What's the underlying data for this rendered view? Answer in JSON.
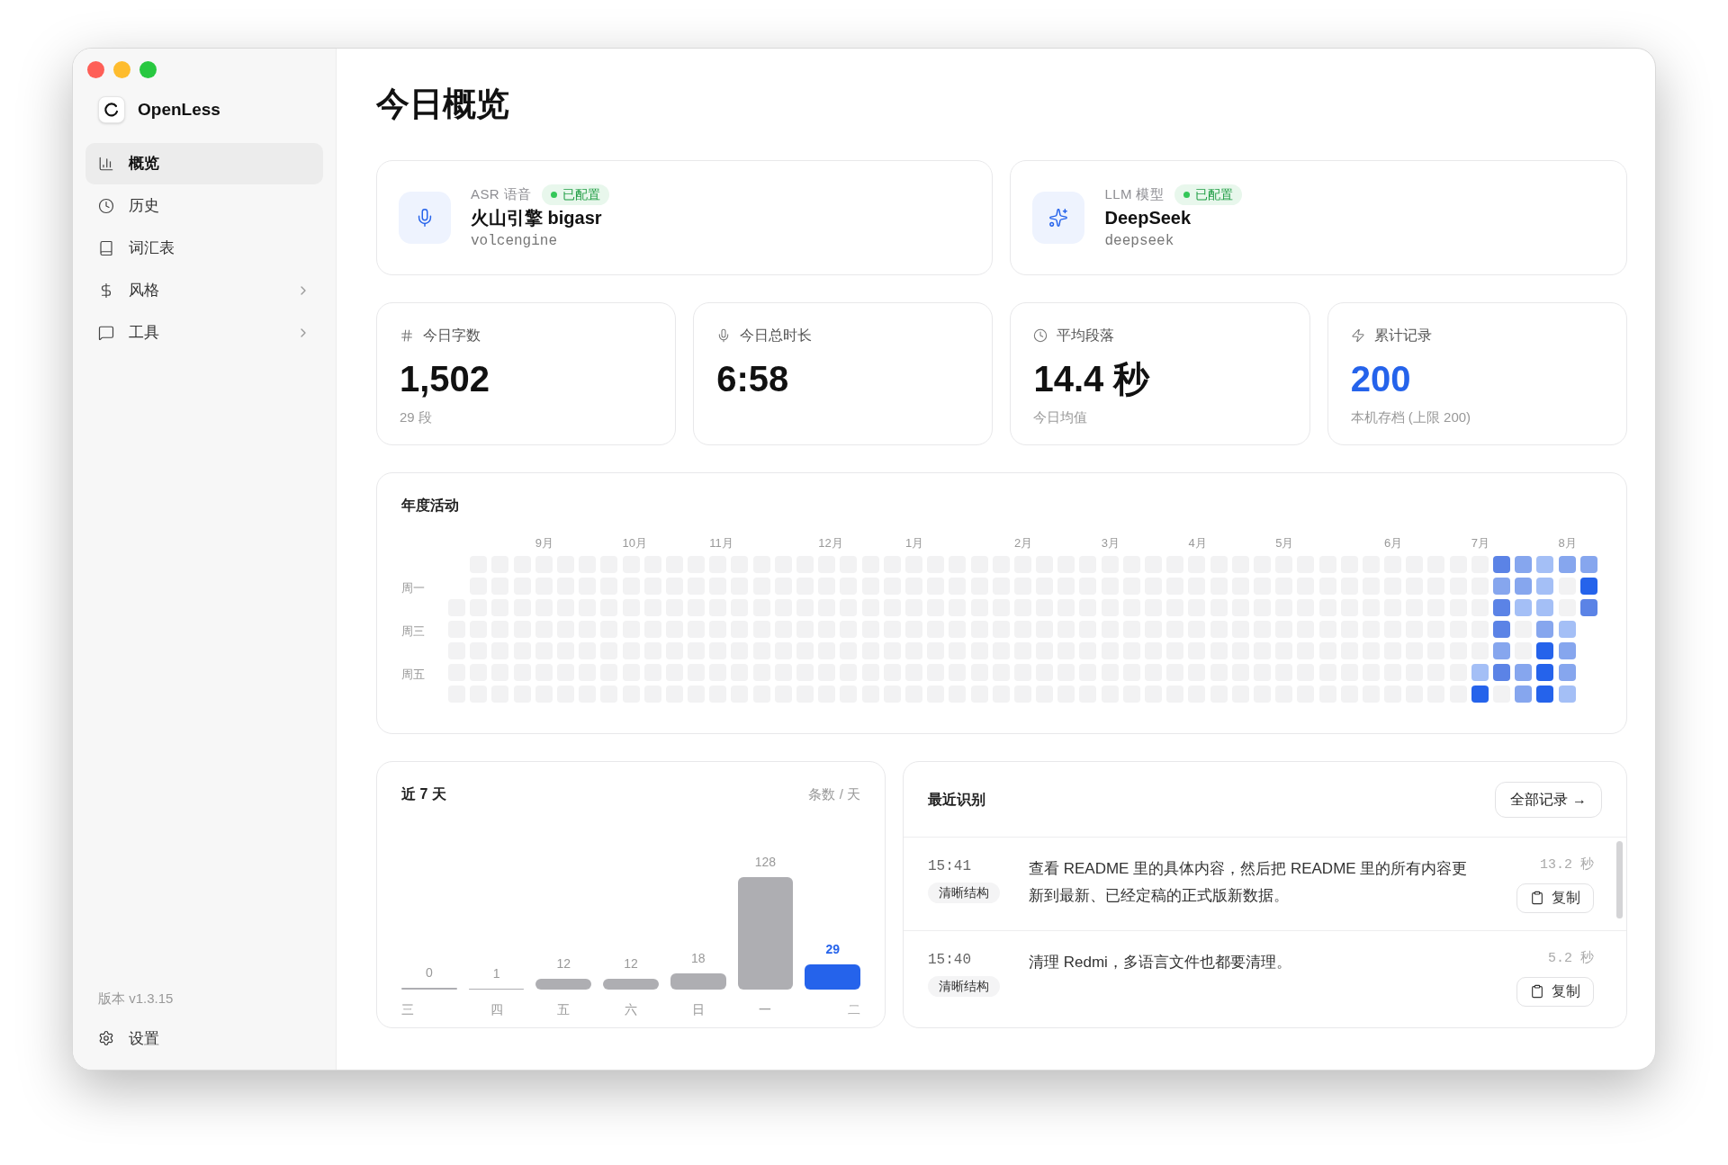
{
  "sidebar": {
    "app_name": "OpenLess",
    "items": [
      {
        "label": "概览",
        "selected": true,
        "has_submenu": false
      },
      {
        "label": "历史",
        "selected": false,
        "has_submenu": false
      },
      {
        "label": "词汇表",
        "selected": false,
        "has_submenu": false
      },
      {
        "label": "风格",
        "selected": false,
        "has_submenu": true
      },
      {
        "label": "工具",
        "selected": false,
        "has_submenu": true
      }
    ],
    "version": "版本 v1.3.15",
    "settings": "设置"
  },
  "page_title": "今日概览",
  "providers": [
    {
      "label": "ASR 语音",
      "status": {
        "label": "已配置",
        "color": "#34c759"
      },
      "name": "火山引擎 bigasr",
      "id": "volcengine"
    },
    {
      "label": "LLM 模型",
      "status": {
        "label": "已配置",
        "color": "#34c759"
      },
      "name": "DeepSeek",
      "id": "deepseek"
    }
  ],
  "stats": [
    {
      "label": "今日字数",
      "value": "1,502",
      "sub": "29 段",
      "accent": false
    },
    {
      "label": "今日总时长",
      "value": "6:58",
      "accent": false
    },
    {
      "label": "平均段落",
      "value": "14.4 秒",
      "sub": "今日均值",
      "accent": false
    },
    {
      "label": "累计记录",
      "value": "200",
      "sub": "本机存档 (上限 200)",
      "accent": true
    }
  ],
  "activity": {
    "title": "年度活动",
    "day_labels": [
      "周一",
      "周三",
      "周五"
    ],
    "weeks": [
      {
        "cells": [
          null,
          null,
          {
            "color": "#f2f2f3"
          },
          {
            "color": "#f2f2f3"
          },
          {
            "color": "#f2f2f3"
          },
          {
            "color": "#f2f2f3"
          },
          {
            "color": "#f2f2f3"
          }
        ]
      },
      {
        "cells": [
          {
            "color": "#f2f2f3"
          },
          {
            "color": "#f2f2f3"
          },
          {
            "color": "#f2f2f3"
          },
          {
            "color": "#f2f2f3"
          },
          {
            "color": "#f2f2f3"
          },
          {
            "color": "#f2f2f3"
          },
          {
            "color": "#f2f2f3"
          }
        ]
      },
      {
        "cells": [
          {
            "color": "#f2f2f3"
          },
          {
            "color": "#f2f2f3"
          },
          {
            "color": "#f2f2f3"
          },
          {
            "color": "#f2f2f3"
          },
          {
            "color": "#f2f2f3"
          },
          {
            "color": "#f2f2f3"
          },
          {
            "color": "#f2f2f3"
          }
        ]
      },
      {
        "cells": [
          {
            "color": "#f2f2f3"
          },
          {
            "color": "#f2f2f3"
          },
          {
            "color": "#f2f2f3"
          },
          {
            "color": "#f2f2f3"
          },
          {
            "color": "#f2f2f3"
          },
          {
            "color": "#f2f2f3"
          },
          {
            "color": "#f2f2f3"
          }
        ]
      },
      {
        "month": "9月",
        "cells": [
          {
            "color": "#f2f2f3"
          },
          {
            "color": "#f2f2f3"
          },
          {
            "color": "#f2f2f3"
          },
          {
            "color": "#f2f2f3"
          },
          {
            "color": "#f2f2f3"
          },
          {
            "color": "#f2f2f3"
          },
          {
            "color": "#f2f2f3"
          }
        ]
      },
      {
        "cells": [
          {
            "color": "#f2f2f3"
          },
          {
            "color": "#f2f2f3"
          },
          {
            "color": "#f2f2f3"
          },
          {
            "color": "#f2f2f3"
          },
          {
            "color": "#f2f2f3"
          },
          {
            "color": "#f2f2f3"
          },
          {
            "color": "#f2f2f3"
          }
        ]
      },
      {
        "cells": [
          {
            "color": "#f2f2f3"
          },
          {
            "color": "#f2f2f3"
          },
          {
            "color": "#f2f2f3"
          },
          {
            "color": "#f2f2f3"
          },
          {
            "color": "#f2f2f3"
          },
          {
            "color": "#f2f2f3"
          },
          {
            "color": "#f2f2f3"
          }
        ]
      },
      {
        "cells": [
          {
            "color": "#f2f2f3"
          },
          {
            "color": "#f2f2f3"
          },
          {
            "color": "#f2f2f3"
          },
          {
            "color": "#f2f2f3"
          },
          {
            "color": "#f2f2f3"
          },
          {
            "color": "#f2f2f3"
          },
          {
            "color": "#f2f2f3"
          }
        ]
      },
      {
        "month": "10月",
        "cells": [
          {
            "color": "#f2f2f3"
          },
          {
            "color": "#f2f2f3"
          },
          {
            "color": "#f2f2f3"
          },
          {
            "color": "#f2f2f3"
          },
          {
            "color": "#f2f2f3"
          },
          {
            "color": "#f2f2f3"
          },
          {
            "color": "#f2f2f3"
          }
        ]
      },
      {
        "cells": [
          {
            "color": "#f2f2f3"
          },
          {
            "color": "#f2f2f3"
          },
          {
            "color": "#f2f2f3"
          },
          {
            "color": "#f2f2f3"
          },
          {
            "color": "#f2f2f3"
          },
          {
            "color": "#f2f2f3"
          },
          {
            "color": "#f2f2f3"
          }
        ]
      },
      {
        "cells": [
          {
            "color": "#f2f2f3"
          },
          {
            "color": "#f2f2f3"
          },
          {
            "color": "#f2f2f3"
          },
          {
            "color": "#f2f2f3"
          },
          {
            "color": "#f2f2f3"
          },
          {
            "color": "#f2f2f3"
          },
          {
            "color": "#f2f2f3"
          }
        ]
      },
      {
        "cells": [
          {
            "color": "#f2f2f3"
          },
          {
            "color": "#f2f2f3"
          },
          {
            "color": "#f2f2f3"
          },
          {
            "color": "#f2f2f3"
          },
          {
            "color": "#f2f2f3"
          },
          {
            "color": "#f2f2f3"
          },
          {
            "color": "#f2f2f3"
          }
        ]
      },
      {
        "month": "11月",
        "cells": [
          {
            "color": "#f2f2f3"
          },
          {
            "color": "#f2f2f3"
          },
          {
            "color": "#f2f2f3"
          },
          {
            "color": "#f2f2f3"
          },
          {
            "color": "#f2f2f3"
          },
          {
            "color": "#f2f2f3"
          },
          {
            "color": "#f2f2f3"
          }
        ]
      },
      {
        "cells": [
          {
            "color": "#f2f2f3"
          },
          {
            "color": "#f2f2f3"
          },
          {
            "color": "#f2f2f3"
          },
          {
            "color": "#f2f2f3"
          },
          {
            "color": "#f2f2f3"
          },
          {
            "color": "#f2f2f3"
          },
          {
            "color": "#f2f2f3"
          }
        ]
      },
      {
        "cells": [
          {
            "color": "#f2f2f3"
          },
          {
            "color": "#f2f2f3"
          },
          {
            "color": "#f2f2f3"
          },
          {
            "color": "#f2f2f3"
          },
          {
            "color": "#f2f2f3"
          },
          {
            "color": "#f2f2f3"
          },
          {
            "color": "#f2f2f3"
          }
        ]
      },
      {
        "cells": [
          {
            "color": "#f2f2f3"
          },
          {
            "color": "#f2f2f3"
          },
          {
            "color": "#f2f2f3"
          },
          {
            "color": "#f2f2f3"
          },
          {
            "color": "#f2f2f3"
          },
          {
            "color": "#f2f2f3"
          },
          {
            "color": "#f2f2f3"
          }
        ]
      },
      {
        "cells": [
          {
            "color": "#f2f2f3"
          },
          {
            "color": "#f2f2f3"
          },
          {
            "color": "#f2f2f3"
          },
          {
            "color": "#f2f2f3"
          },
          {
            "color": "#f2f2f3"
          },
          {
            "color": "#f2f2f3"
          },
          {
            "color": "#f2f2f3"
          }
        ]
      },
      {
        "month": "12月",
        "cells": [
          {
            "color": "#f2f2f3"
          },
          {
            "color": "#f2f2f3"
          },
          {
            "color": "#f2f2f3"
          },
          {
            "color": "#f2f2f3"
          },
          {
            "color": "#f2f2f3"
          },
          {
            "color": "#f2f2f3"
          },
          {
            "color": "#f2f2f3"
          }
        ]
      },
      {
        "cells": [
          {
            "color": "#f2f2f3"
          },
          {
            "color": "#f2f2f3"
          },
          {
            "color": "#f2f2f3"
          },
          {
            "color": "#f2f2f3"
          },
          {
            "color": "#f2f2f3"
          },
          {
            "color": "#f2f2f3"
          },
          {
            "color": "#f2f2f3"
          }
        ]
      },
      {
        "cells": [
          {
            "color": "#f2f2f3"
          },
          {
            "color": "#f2f2f3"
          },
          {
            "color": "#f2f2f3"
          },
          {
            "color": "#f2f2f3"
          },
          {
            "color": "#f2f2f3"
          },
          {
            "color": "#f2f2f3"
          },
          {
            "color": "#f2f2f3"
          }
        ]
      },
      {
        "cells": [
          {
            "color": "#f2f2f3"
          },
          {
            "color": "#f2f2f3"
          },
          {
            "color": "#f2f2f3"
          },
          {
            "color": "#f2f2f3"
          },
          {
            "color": "#f2f2f3"
          },
          {
            "color": "#f2f2f3"
          },
          {
            "color": "#f2f2f3"
          }
        ]
      },
      {
        "month": "1月",
        "cells": [
          {
            "color": "#f2f2f3"
          },
          {
            "color": "#f2f2f3"
          },
          {
            "color": "#f2f2f3"
          },
          {
            "color": "#f2f2f3"
          },
          {
            "color": "#f2f2f3"
          },
          {
            "color": "#f2f2f3"
          },
          {
            "color": "#f2f2f3"
          }
        ]
      },
      {
        "cells": [
          {
            "color": "#f2f2f3"
          },
          {
            "color": "#f2f2f3"
          },
          {
            "color": "#f2f2f3"
          },
          {
            "color": "#f2f2f3"
          },
          {
            "color": "#f2f2f3"
          },
          {
            "color": "#f2f2f3"
          },
          {
            "color": "#f2f2f3"
          }
        ]
      },
      {
        "cells": [
          {
            "color": "#f2f2f3"
          },
          {
            "color": "#f2f2f3"
          },
          {
            "color": "#f2f2f3"
          },
          {
            "color": "#f2f2f3"
          },
          {
            "color": "#f2f2f3"
          },
          {
            "color": "#f2f2f3"
          },
          {
            "color": "#f2f2f3"
          }
        ]
      },
      {
        "cells": [
          {
            "color": "#f2f2f3"
          },
          {
            "color": "#f2f2f3"
          },
          {
            "color": "#f2f2f3"
          },
          {
            "color": "#f2f2f3"
          },
          {
            "color": "#f2f2f3"
          },
          {
            "color": "#f2f2f3"
          },
          {
            "color": "#f2f2f3"
          }
        ]
      },
      {
        "cells": [
          {
            "color": "#f2f2f3"
          },
          {
            "color": "#f2f2f3"
          },
          {
            "color": "#f2f2f3"
          },
          {
            "color": "#f2f2f3"
          },
          {
            "color": "#f2f2f3"
          },
          {
            "color": "#f2f2f3"
          },
          {
            "color": "#f2f2f3"
          }
        ]
      },
      {
        "month": "2月",
        "cells": [
          {
            "color": "#f2f2f3"
          },
          {
            "color": "#f2f2f3"
          },
          {
            "color": "#f2f2f3"
          },
          {
            "color": "#f2f2f3"
          },
          {
            "color": "#f2f2f3"
          },
          {
            "color": "#f2f2f3"
          },
          {
            "color": "#f2f2f3"
          }
        ]
      },
      {
        "cells": [
          {
            "color": "#f2f2f3"
          },
          {
            "color": "#f2f2f3"
          },
          {
            "color": "#f2f2f3"
          },
          {
            "color": "#f2f2f3"
          },
          {
            "color": "#f2f2f3"
          },
          {
            "color": "#f2f2f3"
          },
          {
            "color": "#f2f2f3"
          }
        ]
      },
      {
        "cells": [
          {
            "color": "#f2f2f3"
          },
          {
            "color": "#f2f2f3"
          },
          {
            "color": "#f2f2f3"
          },
          {
            "color": "#f2f2f3"
          },
          {
            "color": "#f2f2f3"
          },
          {
            "color": "#f2f2f3"
          },
          {
            "color": "#f2f2f3"
          }
        ]
      },
      {
        "cells": [
          {
            "color": "#f2f2f3"
          },
          {
            "color": "#f2f2f3"
          },
          {
            "color": "#f2f2f3"
          },
          {
            "color": "#f2f2f3"
          },
          {
            "color": "#f2f2f3"
          },
          {
            "color": "#f2f2f3"
          },
          {
            "color": "#f2f2f3"
          }
        ]
      },
      {
        "month": "3月",
        "cells": [
          {
            "color": "#f2f2f3"
          },
          {
            "color": "#f2f2f3"
          },
          {
            "color": "#f2f2f3"
          },
          {
            "color": "#f2f2f3"
          },
          {
            "color": "#f2f2f3"
          },
          {
            "color": "#f2f2f3"
          },
          {
            "color": "#f2f2f3"
          }
        ]
      },
      {
        "cells": [
          {
            "color": "#f2f2f3"
          },
          {
            "color": "#f2f2f3"
          },
          {
            "color": "#f2f2f3"
          },
          {
            "color": "#f2f2f3"
          },
          {
            "color": "#f2f2f3"
          },
          {
            "color": "#f2f2f3"
          },
          {
            "color": "#f2f2f3"
          }
        ]
      },
      {
        "cells": [
          {
            "color": "#f2f2f3"
          },
          {
            "color": "#f2f2f3"
          },
          {
            "color": "#f2f2f3"
          },
          {
            "color": "#f2f2f3"
          },
          {
            "color": "#f2f2f3"
          },
          {
            "color": "#f2f2f3"
          },
          {
            "color": "#f2f2f3"
          }
        ]
      },
      {
        "cells": [
          {
            "color": "#f2f2f3"
          },
          {
            "color": "#f2f2f3"
          },
          {
            "color": "#f2f2f3"
          },
          {
            "color": "#f2f2f3"
          },
          {
            "color": "#f2f2f3"
          },
          {
            "color": "#f2f2f3"
          },
          {
            "color": "#f2f2f3"
          }
        ]
      },
      {
        "month": "4月",
        "cells": [
          {
            "color": "#f2f2f3"
          },
          {
            "color": "#f2f2f3"
          },
          {
            "color": "#f2f2f3"
          },
          {
            "color": "#f2f2f3"
          },
          {
            "color": "#f2f2f3"
          },
          {
            "color": "#f2f2f3"
          },
          {
            "color": "#f2f2f3"
          }
        ]
      },
      {
        "cells": [
          {
            "color": "#f2f2f3"
          },
          {
            "color": "#f2f2f3"
          },
          {
            "color": "#f2f2f3"
          },
          {
            "color": "#f2f2f3"
          },
          {
            "color": "#f2f2f3"
          },
          {
            "color": "#f2f2f3"
          },
          {
            "color": "#f2f2f3"
          }
        ]
      },
      {
        "cells": [
          {
            "color": "#f2f2f3"
          },
          {
            "color": "#f2f2f3"
          },
          {
            "color": "#f2f2f3"
          },
          {
            "color": "#f2f2f3"
          },
          {
            "color": "#f2f2f3"
          },
          {
            "color": "#f2f2f3"
          },
          {
            "color": "#f2f2f3"
          }
        ]
      },
      {
        "cells": [
          {
            "color": "#f2f2f3"
          },
          {
            "color": "#f2f2f3"
          },
          {
            "color": "#f2f2f3"
          },
          {
            "color": "#f2f2f3"
          },
          {
            "color": "#f2f2f3"
          },
          {
            "color": "#f2f2f3"
          },
          {
            "color": "#f2f2f3"
          }
        ]
      },
      {
        "month": "5月",
        "cells": [
          {
            "color": "#f2f2f3"
          },
          {
            "color": "#f2f2f3"
          },
          {
            "color": "#f2f2f3"
          },
          {
            "color": "#f2f2f3"
          },
          {
            "color": "#f2f2f3"
          },
          {
            "color": "#f2f2f3"
          },
          {
            "color": "#f2f2f3"
          }
        ]
      },
      {
        "cells": [
          {
            "color": "#f2f2f3"
          },
          {
            "color": "#f2f2f3"
          },
          {
            "color": "#f2f2f3"
          },
          {
            "color": "#f2f2f3"
          },
          {
            "color": "#f2f2f3"
          },
          {
            "color": "#f2f2f3"
          },
          {
            "color": "#f2f2f3"
          }
        ]
      },
      {
        "cells": [
          {
            "color": "#f2f2f3"
          },
          {
            "color": "#f2f2f3"
          },
          {
            "color": "#f2f2f3"
          },
          {
            "color": "#f2f2f3"
          },
          {
            "color": "#f2f2f3"
          },
          {
            "color": "#f2f2f3"
          },
          {
            "color": "#f2f2f3"
          }
        ]
      },
      {
        "cells": [
          {
            "color": "#f2f2f3"
          },
          {
            "color": "#f2f2f3"
          },
          {
            "color": "#f2f2f3"
          },
          {
            "color": "#f2f2f3"
          },
          {
            "color": "#f2f2f3"
          },
          {
            "color": "#f2f2f3"
          },
          {
            "color": "#f2f2f3"
          }
        ]
      },
      {
        "cells": [
          {
            "color": "#f2f2f3"
          },
          {
            "color": "#f2f2f3"
          },
          {
            "color": "#f2f2f3"
          },
          {
            "color": "#f2f2f3"
          },
          {
            "color": "#f2f2f3"
          },
          {
            "color": "#f2f2f3"
          },
          {
            "color": "#f2f2f3"
          }
        ]
      },
      {
        "month": "6月",
        "cells": [
          {
            "color": "#f2f2f3"
          },
          {
            "color": "#f2f2f3"
          },
          {
            "color": "#f2f2f3"
          },
          {
            "color": "#f2f2f3"
          },
          {
            "color": "#f2f2f3"
          },
          {
            "color": "#f2f2f3"
          },
          {
            "color": "#f2f2f3"
          }
        ]
      },
      {
        "cells": [
          {
            "color": "#f2f2f3"
          },
          {
            "color": "#f2f2f3"
          },
          {
            "color": "#f2f2f3"
          },
          {
            "color": "#f2f2f3"
          },
          {
            "color": "#f2f2f3"
          },
          {
            "color": "#f2f2f3"
          },
          {
            "color": "#f2f2f3"
          }
        ]
      },
      {
        "cells": [
          {
            "color": "#f2f2f3"
          },
          {
            "color": "#f2f2f3"
          },
          {
            "color": "#f2f2f3"
          },
          {
            "color": "#f2f2f3"
          },
          {
            "color": "#f2f2f3"
          },
          {
            "color": "#f2f2f3"
          },
          {
            "color": "#f2f2f3"
          }
        ]
      },
      {
        "cells": [
          {
            "color": "#f2f2f3"
          },
          {
            "color": "#f2f2f3"
          },
          {
            "color": "#f2f2f3"
          },
          {
            "color": "#f2f2f3"
          },
          {
            "color": "#f2f2f3"
          },
          {
            "color": "#f2f2f3"
          },
          {
            "color": "#f2f2f3"
          }
        ]
      },
      {
        "month": "7月",
        "cells": [
          {
            "color": "#f2f2f3"
          },
          {
            "color": "#f2f2f3"
          },
          {
            "color": "#f2f2f3"
          },
          {
            "color": "#f2f2f3"
          },
          {
            "color": "#f2f2f3"
          },
          {
            "color": "#a4bff6"
          },
          {
            "color": "#2563eb"
          }
        ]
      },
      {
        "cells": [
          {
            "color": "#5b83e6"
          },
          {
            "color": "#86a6ee"
          },
          {
            "color": "#5b83e6"
          },
          {
            "color": "#5b83e6"
          },
          {
            "color": "#86a6ee"
          },
          {
            "color": "#5b83e6"
          },
          {
            "color": "#f2f2f3"
          }
        ]
      },
      {
        "cells": [
          {
            "color": "#86a6ee"
          },
          {
            "color": "#86a6ee"
          },
          {
            "color": "#a4bff6"
          },
          {
            "color": "#f2f2f3"
          },
          {
            "color": "#f2f2f3"
          },
          {
            "color": "#86a6ee"
          },
          {
            "color": "#86a6ee"
          }
        ]
      },
      {
        "cells": [
          {
            "color": "#a4bff6"
          },
          {
            "color": "#a4bff6"
          },
          {
            "color": "#a4bff6"
          },
          {
            "color": "#86a6ee"
          },
          {
            "color": "#2563eb"
          },
          {
            "color": "#2563eb"
          },
          {
            "color": "#2563eb"
          }
        ]
      },
      {
        "month": "8月",
        "cells": [
          {
            "color": "#86a6ee"
          },
          {
            "color": "#f2f2f3"
          },
          {
            "color": "#f2f2f3"
          },
          {
            "color": "#a4bff6"
          },
          {
            "color": "#86a6ee"
          },
          {
            "color": "#86a6ee"
          },
          {
            "color": "#a4bff6"
          }
        ]
      },
      {
        "cells": [
          {
            "color": "#86a6ee"
          },
          {
            "color": "#2563eb"
          },
          {
            "color": "#5b83e6"
          }
        ]
      }
    ]
  },
  "last7": {
    "title": "近 7 天",
    "chart_data": {
      "type": "bar",
      "categories": [
        "三",
        "四",
        "五",
        "六",
        "日",
        "一",
        "二"
      ],
      "series": [
        {
          "name": "条数 / 天",
          "color": "#aeaeb2",
          "values": [
            0,
            1,
            12,
            12,
            18,
            128,
            null
          ]
        },
        {
          "color": "#2563eb",
          "values": [
            null,
            null,
            null,
            null,
            null,
            null,
            29
          ]
        }
      ],
      "data_labels": true
    }
  },
  "recent": {
    "title": "最近识别",
    "all_button": "全部记录 →",
    "items": [
      {
        "time": "15:41",
        "tag": "清晰结构",
        "text": "查看 README 里的具体内容，然后把 README 里的所有内容更新到最新、已经定稿的正式版新数据。",
        "duration": "13.2 秒",
        "copy": "复制"
      },
      {
        "time": "15:40",
        "tag": "清晰结构",
        "text": "清理 Redmi，多语言文件也都要清理。",
        "duration": "5.2 秒",
        "copy": "复制"
      }
    ]
  }
}
